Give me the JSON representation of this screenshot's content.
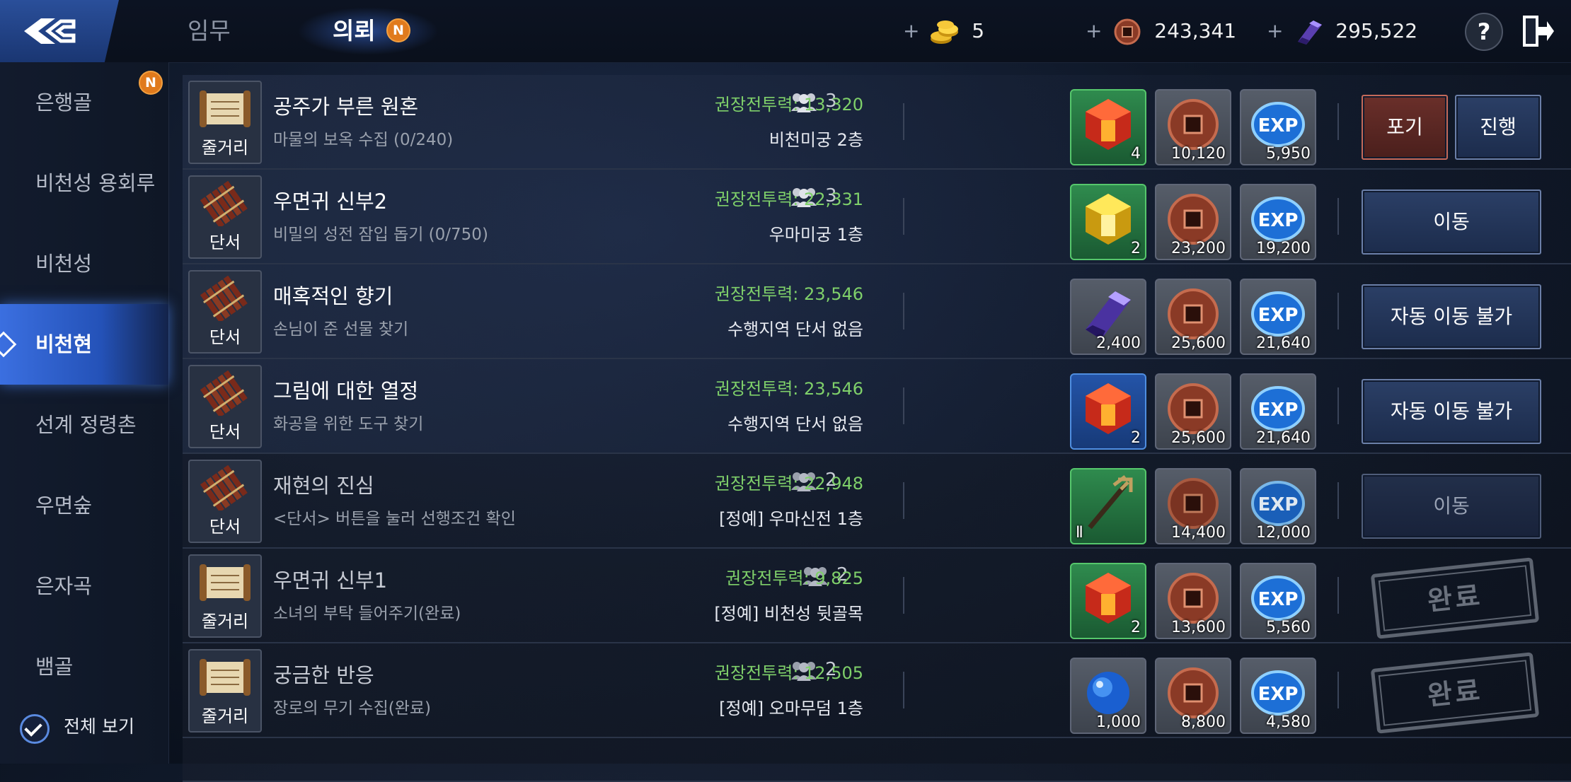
{
  "header": {
    "tabs": [
      {
        "label": "임무",
        "active": false
      },
      {
        "label": "의뢰",
        "active": true,
        "badge": "N"
      }
    ],
    "currencies": [
      {
        "icon": "gold-coin-icon",
        "value": "5"
      },
      {
        "icon": "copper-coin-icon",
        "value": "243,341"
      },
      {
        "icon": "purple-crystal-icon",
        "value": "295,522"
      }
    ],
    "plus": "+",
    "help_label": "?"
  },
  "sidebar": {
    "items": [
      {
        "label": "은행골",
        "badge": "N",
        "active": false
      },
      {
        "label": "비천성 용회루",
        "active": false
      },
      {
        "label": "비천성",
        "active": false
      },
      {
        "label": "비천현",
        "active": true
      },
      {
        "label": "선계 정령촌",
        "active": false
      },
      {
        "label": "우면숲",
        "active": false
      },
      {
        "label": "은자곡",
        "active": false
      },
      {
        "label": "뱀골",
        "active": false
      }
    ],
    "view_all": {
      "label": "전체 보기",
      "checked": true
    }
  },
  "quests": [
    {
      "type": "줄거리",
      "type_icon": "scroll-icon",
      "title": "공주가 부른 원혼",
      "subtitle": "마물의 보옥 수집 (0/240)",
      "party": "3",
      "power": "권장전투력: 13,320",
      "location": "비천미궁 2층",
      "rewards": [
        {
          "icon": "red-gem-icon",
          "count": "4",
          "frame": "green"
        },
        {
          "icon": "copper-coin-icon",
          "count": "10,120"
        },
        {
          "icon": "exp-icon",
          "count": "5,950"
        }
      ],
      "buttons": [
        "포기",
        "진행"
      ],
      "state": "active"
    },
    {
      "type": "단서",
      "type_icon": "bamboo-scroll-icon",
      "title": "우면귀 신부2",
      "subtitle": "비밀의 성전 잠입 돕기 (0/750)",
      "party": "3",
      "power": "권장전투력: 22,331",
      "location": "우마미궁 1층",
      "rewards": [
        {
          "icon": "yellow-gem-icon",
          "count": "2",
          "frame": "green"
        },
        {
          "icon": "copper-coin-icon",
          "count": "23,200"
        },
        {
          "icon": "exp-icon",
          "count": "19,200"
        }
      ],
      "buttons": [
        "이동"
      ],
      "state": "normal"
    },
    {
      "type": "단서",
      "type_icon": "bamboo-scroll-icon",
      "title": "매혹적인 향기",
      "subtitle": "손님이 준 선물 찾기",
      "party": "",
      "power": "권장전투력: 23,546",
      "location": "수행지역 단서 없음",
      "rewards": [
        {
          "icon": "purple-crystal-icon",
          "count": "2,400",
          "frame": "gray"
        },
        {
          "icon": "copper-coin-icon",
          "count": "25,600"
        },
        {
          "icon": "exp-icon",
          "count": "21,640"
        }
      ],
      "buttons": [
        "자동 이동 불가"
      ],
      "state": "normal"
    },
    {
      "type": "단서",
      "type_icon": "bamboo-scroll-icon",
      "title": "그림에 대한 열정",
      "subtitle": "화공을 위한 도구 찾기",
      "party": "",
      "power": "권장전투력: 23,546",
      "location": "수행지역 단서 없음",
      "rewards": [
        {
          "icon": "red-gem-icon",
          "count": "2",
          "frame": "blue"
        },
        {
          "icon": "copper-coin-icon",
          "count": "25,600"
        },
        {
          "icon": "exp-icon",
          "count": "21,640"
        }
      ],
      "buttons": [
        "자동 이동 불가"
      ],
      "state": "normal"
    },
    {
      "type": "단서",
      "type_icon": "bamboo-scroll-icon",
      "title": "재현의 진심",
      "subtitle": "<단서> 버튼을 눌러 선행조건 확인",
      "party": "2",
      "power": "권장전투력: 22,948",
      "location": "[정예] 우마신전 1층",
      "rewards": [
        {
          "icon": "trident-icon",
          "count": "Ⅱ",
          "frame": "green"
        },
        {
          "icon": "copper-coin-icon",
          "count": "14,400"
        },
        {
          "icon": "exp-icon",
          "count": "12,000"
        }
      ],
      "buttons": [
        "이동"
      ],
      "state": "dim"
    },
    {
      "type": "줄거리",
      "type_icon": "scroll-icon",
      "title": "우면귀 신부1",
      "subtitle": "소녀의 부탁 들어주기(완료)",
      "party": "2",
      "power": "권장전투력: 9,825",
      "location": "[정예] 비천성 뒷골목",
      "rewards": [
        {
          "icon": "red-gem-icon",
          "count": "2",
          "frame": "green"
        },
        {
          "icon": "copper-coin-icon",
          "count": "13,600"
        },
        {
          "icon": "exp-icon",
          "count": "5,560"
        }
      ],
      "buttons": [],
      "stamp": "완료",
      "state": "done"
    },
    {
      "type": "줄거리",
      "type_icon": "scroll-icon",
      "title": "궁금한 반응",
      "subtitle": "장로의 무기 수집(완료)",
      "party": "2",
      "power": "권장전투력: 12,505",
      "location": "[정예] 오마무덤 1층",
      "rewards": [
        {
          "icon": "blue-orb-icon",
          "count": "1,000",
          "frame": "gray"
        },
        {
          "icon": "copper-coin-icon",
          "count": "8,800"
        },
        {
          "icon": "exp-icon",
          "count": "4,580"
        }
      ],
      "buttons": [],
      "stamp": "완료",
      "state": "done"
    }
  ],
  "colors": {
    "power_text": "#7fd06a",
    "active_tab": "#3b6fe0",
    "badge": "#e07a1c"
  }
}
